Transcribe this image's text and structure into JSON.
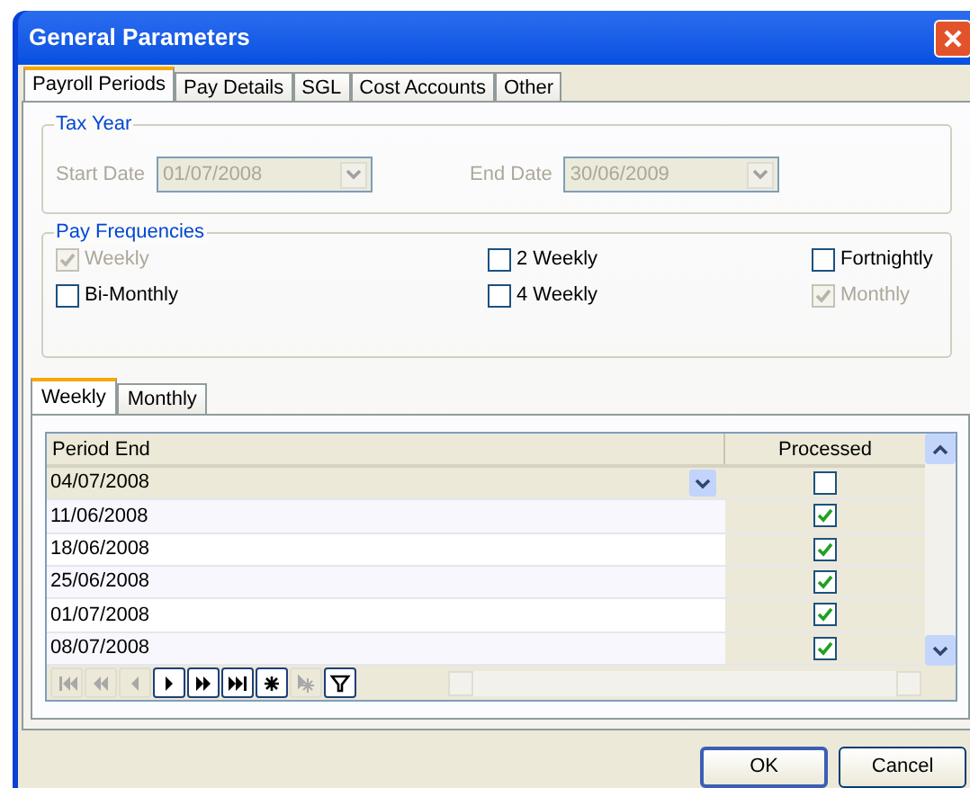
{
  "window": {
    "title": "General Parameters"
  },
  "tabs": [
    {
      "label": "Payroll Periods",
      "selected": true
    },
    {
      "label": "Pay Details",
      "selected": false
    },
    {
      "label": "SGL",
      "selected": false
    },
    {
      "label": "Cost Accounts",
      "selected": false
    },
    {
      "label": "Other",
      "selected": false
    }
  ],
  "tax_year": {
    "title": "Tax Year",
    "fields": [
      {
        "label": "Start Date",
        "value": "01/07/2008",
        "disabled": true
      },
      {
        "label": "End Date",
        "value": "30/06/2009",
        "disabled": true
      }
    ]
  },
  "pay_frequencies": {
    "title": "Pay Frequencies",
    "items": [
      {
        "label": "Weekly",
        "checked": true,
        "disabled": true
      },
      {
        "label": "2 Weekly",
        "checked": false,
        "disabled": false
      },
      {
        "label": "Fortnightly",
        "checked": false,
        "disabled": false
      },
      {
        "label": "Bi-Monthly",
        "checked": false,
        "disabled": false
      },
      {
        "label": "4 Weekly",
        "checked": false,
        "disabled": false
      },
      {
        "label": "Monthly",
        "checked": true,
        "disabled": true
      }
    ]
  },
  "period_tabs": [
    {
      "label": "Weekly",
      "selected": true
    },
    {
      "label": "Monthly",
      "selected": false
    }
  ],
  "table": {
    "columns": [
      "Period End",
      "Processed"
    ],
    "rows": [
      {
        "period_end": "04/07/2008",
        "processed": false,
        "selected": true
      },
      {
        "period_end": "11/06/2008",
        "processed": true,
        "selected": false
      },
      {
        "period_end": "18/06/2008",
        "processed": true,
        "selected": false
      },
      {
        "period_end": "25/06/2008",
        "processed": true,
        "selected": false
      },
      {
        "period_end": "01/07/2008",
        "processed": true,
        "selected": false
      },
      {
        "period_end": "08/07/2008",
        "processed": true,
        "selected": false
      }
    ]
  },
  "navigator": [
    {
      "kind": "first",
      "disabled": true
    },
    {
      "kind": "prev-page",
      "disabled": true
    },
    {
      "kind": "prev",
      "disabled": true
    },
    {
      "kind": "next",
      "disabled": false
    },
    {
      "kind": "next-page",
      "disabled": false
    },
    {
      "kind": "last",
      "disabled": false
    },
    {
      "kind": "insert",
      "disabled": false
    },
    {
      "kind": "delete",
      "disabled": true
    },
    {
      "kind": "filter",
      "disabled": false
    }
  ],
  "buttons": [
    "OK",
    "Cancel"
  ]
}
